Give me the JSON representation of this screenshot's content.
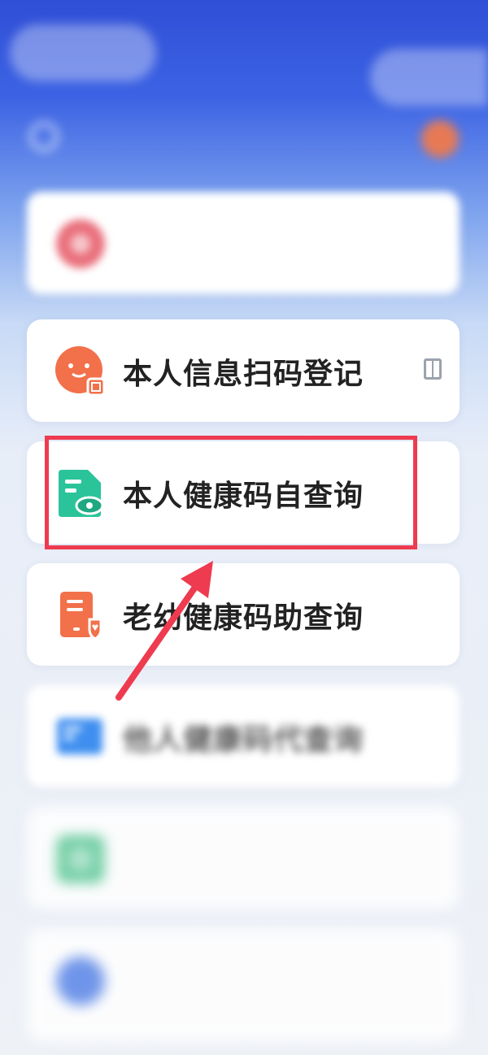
{
  "header": {
    "notice_text": "",
    "avatar_color": "#e77a55"
  },
  "services": [
    {
      "label": "",
      "icon": "red-face-icon",
      "blurred": true
    },
    {
      "label": "本人信息扫码登记",
      "icon": "scan-register-icon"
    },
    {
      "label": "本人健康码自查询",
      "icon": "health-code-self-icon",
      "highlighted": true
    },
    {
      "label": "老幼健康码助查询",
      "icon": "health-code-elderly-icon"
    },
    {
      "label": "他人健康码代查询",
      "icon": "health-code-others-icon",
      "blurred": true
    },
    {
      "label": "",
      "icon": "green-service-icon",
      "blurred": true
    },
    {
      "label": "",
      "icon": "blue-service-icon",
      "blurred": true
    }
  ],
  "annotation": {
    "highlight_color": "#ee3b4f"
  }
}
